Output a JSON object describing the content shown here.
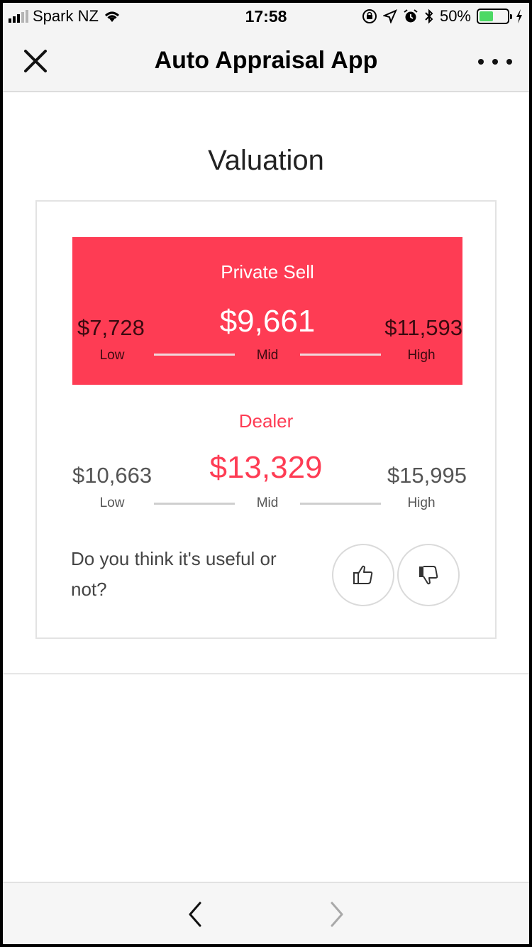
{
  "status_bar": {
    "carrier": "Spark NZ",
    "time": "17:58",
    "battery_percent": "50%",
    "battery_level": 0.5
  },
  "nav": {
    "title": "Auto Appraisal App",
    "close_icon": "close-icon",
    "more_icon": "more-icon"
  },
  "page": {
    "title": "Valuation"
  },
  "private_sell": {
    "label": "Private Sell",
    "low_value": "$7,728",
    "mid_value": "$9,661",
    "high_value": "$11,593",
    "low_label": "Low",
    "mid_label": "Mid",
    "high_label": "High"
  },
  "dealer": {
    "label": "Dealer",
    "low_value": "$10,663",
    "mid_value": "$13,329",
    "high_value": "$15,995",
    "low_label": "Low",
    "mid_label": "Mid",
    "high_label": "High"
  },
  "feedback": {
    "question": "Do you think it's useful or not?",
    "like_icon": "thumbs-up-icon",
    "dislike_icon": "thumbs-down-icon"
  },
  "toolbar": {
    "back_icon": "chevron-left-icon",
    "forward_icon": "chevron-right-icon"
  },
  "colors": {
    "accent": "#fe3c54",
    "battery": "#4cd964"
  }
}
